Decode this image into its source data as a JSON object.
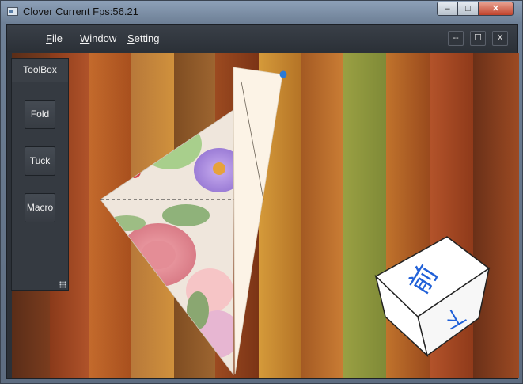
{
  "window": {
    "title": "Clover Current Fps:56.21",
    "controls": {
      "minimize": "–",
      "maximize": "□",
      "close": "✕"
    }
  },
  "menubar": {
    "items": [
      {
        "label": "File",
        "mnemonic": "F",
        "rest": "ile"
      },
      {
        "label": "Window",
        "mnemonic": "W",
        "rest": "indow"
      },
      {
        "label": "Setting",
        "mnemonic": "S",
        "rest": "etting"
      }
    ],
    "controls": {
      "minimize": "--",
      "maximize": "☐",
      "close": "X"
    }
  },
  "toolbox": {
    "title": "ToolBox",
    "buttons": [
      "Fold",
      "Tuck",
      "Macro"
    ]
  },
  "view_cube": {
    "front_glyph": "前",
    "bottom_glyph": "下"
  },
  "icons": {
    "app": "app-window-icon",
    "grip": "resize-grip-icon",
    "handle": "fold-handle-dot"
  },
  "colors": {
    "menubar": "#2e3339",
    "toolbox": "#353a41",
    "handle": "#2a7ad8",
    "cube_glyph": "#2060d8",
    "paper_back": "#fcf3e6"
  }
}
